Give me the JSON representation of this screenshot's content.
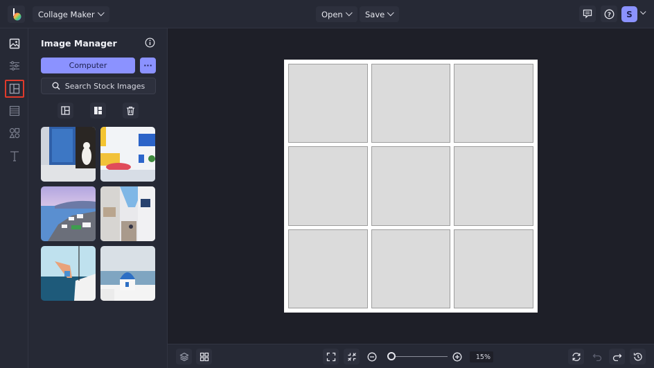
{
  "topbar": {
    "app_menu_label": "Collage Maker",
    "open_label": "Open",
    "save_label": "Save",
    "avatar_initial": "S"
  },
  "rail": {
    "items": [
      {
        "name": "image-manager",
        "icon": "image-icon",
        "active": false
      },
      {
        "name": "edit",
        "icon": "sliders-icon",
        "active": false
      },
      {
        "name": "layouts",
        "icon": "layout-icon",
        "active": true
      },
      {
        "name": "backgrounds",
        "icon": "texture-icon",
        "active": false
      },
      {
        "name": "graphics",
        "icon": "shapes-icon",
        "active": false
      },
      {
        "name": "text",
        "icon": "text-icon",
        "active": false
      }
    ]
  },
  "panel": {
    "title": "Image Manager",
    "computer_label": "Computer",
    "more_label": "···",
    "search_label": "Search Stock Images",
    "thumbnails": [
      {
        "description": "cat by blue window"
      },
      {
        "description": "whitewashed street with flowers"
      },
      {
        "description": "santorini coastline"
      },
      {
        "description": "narrow alley with balconies"
      },
      {
        "description": "man on sailboat"
      },
      {
        "description": "blue dome church"
      }
    ]
  },
  "canvas": {
    "rows": 3,
    "cols": 3,
    "cell_color": "#dbdbdb"
  },
  "bottombar": {
    "zoom_value": "15%",
    "zoom_fraction": 0.05
  },
  "colors": {
    "accent": "#8b92ff",
    "active_outline": "#e03a2b",
    "bar_bg": "#262935",
    "workspace_bg": "#1e1f28"
  }
}
